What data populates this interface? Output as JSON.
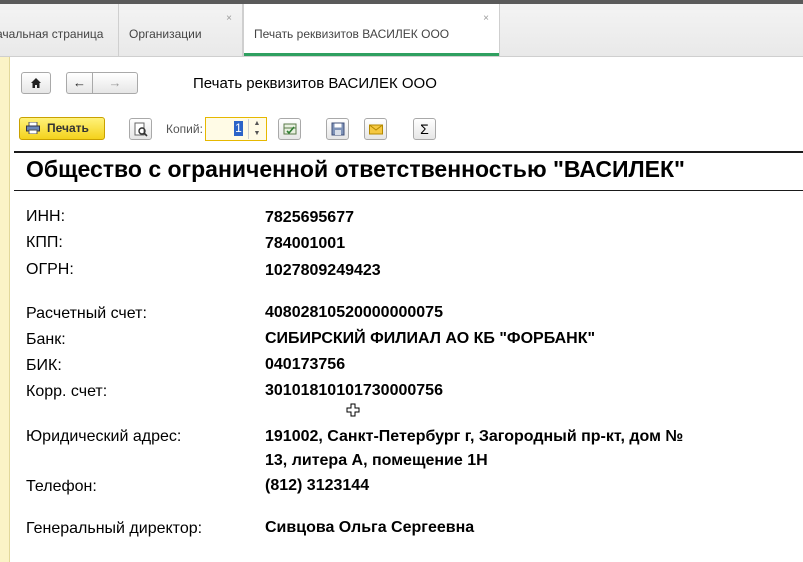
{
  "tabs": [
    {
      "label": "ачальная страница"
    },
    {
      "label": "Организации",
      "close": "×"
    },
    {
      "label": "Печать реквизитов ВАСИЛЕК ООО",
      "close": "×"
    }
  ],
  "nav": {
    "home_icon": "home-icon",
    "back_glyph": "←",
    "forward_glyph": "→",
    "title": "Печать реквизитов ВАСИЛЕК ООО"
  },
  "toolbar": {
    "print_label": "Печать",
    "copies_label": "Копий:",
    "copies_value": "1",
    "sum_glyph": "Σ"
  },
  "document": {
    "org_name": "Общество с ограниченной ответственностью \"ВАСИЛЕК\"",
    "fields": {
      "inn": {
        "label": "ИНН:",
        "value": "7825695677"
      },
      "kpp": {
        "label": "КПП:",
        "value": "784001001"
      },
      "ogrn": {
        "label": "ОГРН:",
        "value": "1027809249423"
      },
      "account": {
        "label": "Расчетный счет:",
        "value": "40802810520000000075"
      },
      "bank": {
        "label": "Банк:",
        "value": "СИБИРСКИЙ ФИЛИАЛ АО КБ \"ФОРБАНК\""
      },
      "bik": {
        "label": "БИК:",
        "value": "040173756"
      },
      "corr": {
        "label": "Корр. счет:",
        "value": "30101810101730000756"
      },
      "address": {
        "label": "Юридический адрес:",
        "value_line1": "191002, Санкт-Петербург г, Загородный пр-кт, дом №",
        "value_line2": "13, литера А, помещение 1Н"
      },
      "phone": {
        "label": "Телефон:",
        "value": "(812) 3123144"
      },
      "director": {
        "label": "Генеральный директор:",
        "value": "Сивцова Ольга Сергеевна"
      }
    }
  },
  "colors": {
    "print_button": "#f4d21c",
    "active_tab_underline": "#2fa060",
    "side_panel": "#fbf3c6"
  }
}
